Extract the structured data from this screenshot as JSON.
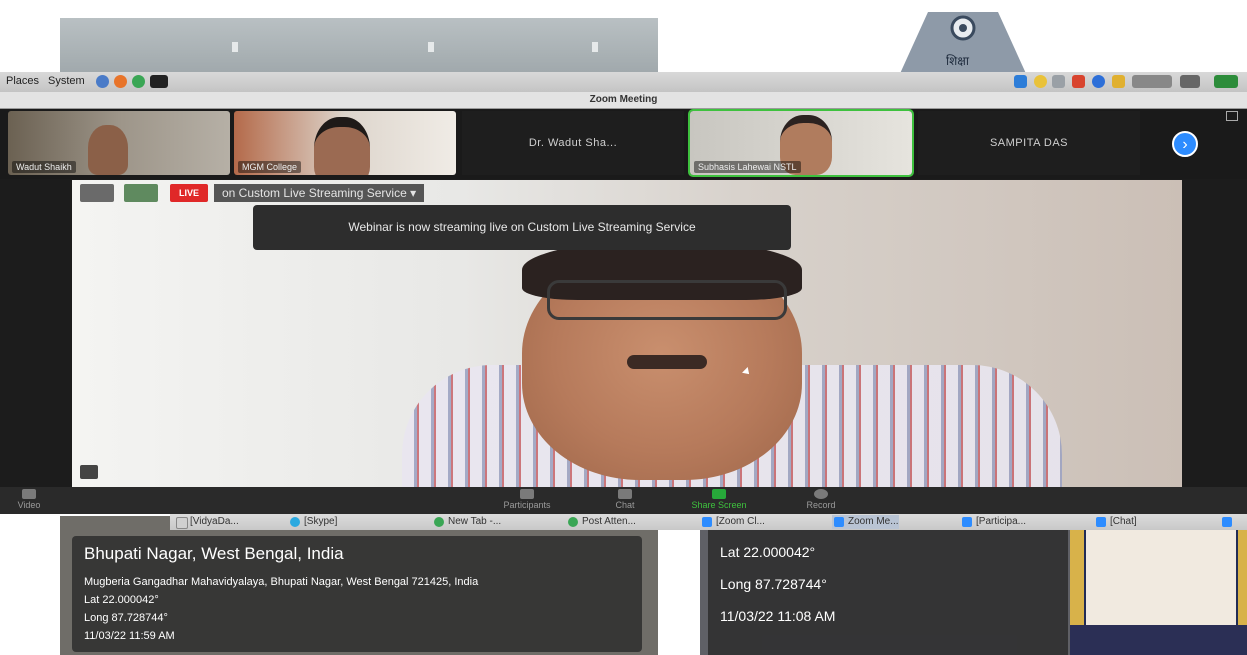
{
  "desktop": {
    "menu_places": "Places",
    "menu_system": "System",
    "building_sign": "शिक्षा"
  },
  "zoom": {
    "window_title": "Zoom Meeting",
    "participants": [
      {
        "name": "Wadut Shaikh"
      },
      {
        "name": "MGM College"
      },
      {
        "name": "Dr. Wadut Sha..."
      },
      {
        "name": "Subhasis Lahewai NSTL"
      },
      {
        "name": "SAMPITA DAS"
      }
    ],
    "live_badge": "LIVE",
    "live_status": "on Custom Live Streaming Service",
    "tooltip": "Webinar is now streaming live on Custom Live Streaming Service",
    "toolbar": {
      "video": "Video",
      "participants": "Participants",
      "chat": "Chat",
      "share_screen": "Share Screen",
      "record": "Record"
    }
  },
  "taskbar": {
    "tasks": [
      "[VidyaDa...",
      "[Skype]",
      "New Tab -...",
      "Post Atten...",
      "[Zoom Cl...",
      "Zoom Me...",
      "[Participa...",
      "[Chat]"
    ]
  },
  "geotag_left": {
    "title": "Bhupati Nagar, West Bengal, India",
    "address": "Mugberia Gangadhar Mahavidyalaya, Bhupati Nagar, West Bengal 721425, India",
    "lat": "Lat 22.000042°",
    "long": "Long 87.728744°",
    "datetime": "11/03/22 11:59 AM"
  },
  "geotag_right": {
    "lat": "Lat 22.000042°",
    "long": "Long 87.728744°",
    "datetime": "11/03/22 11:08 AM"
  },
  "colors": {
    "live_red": "#e02828",
    "active_speaker_border": "#3ec13e",
    "zoom_blue": "#2d8cff"
  }
}
